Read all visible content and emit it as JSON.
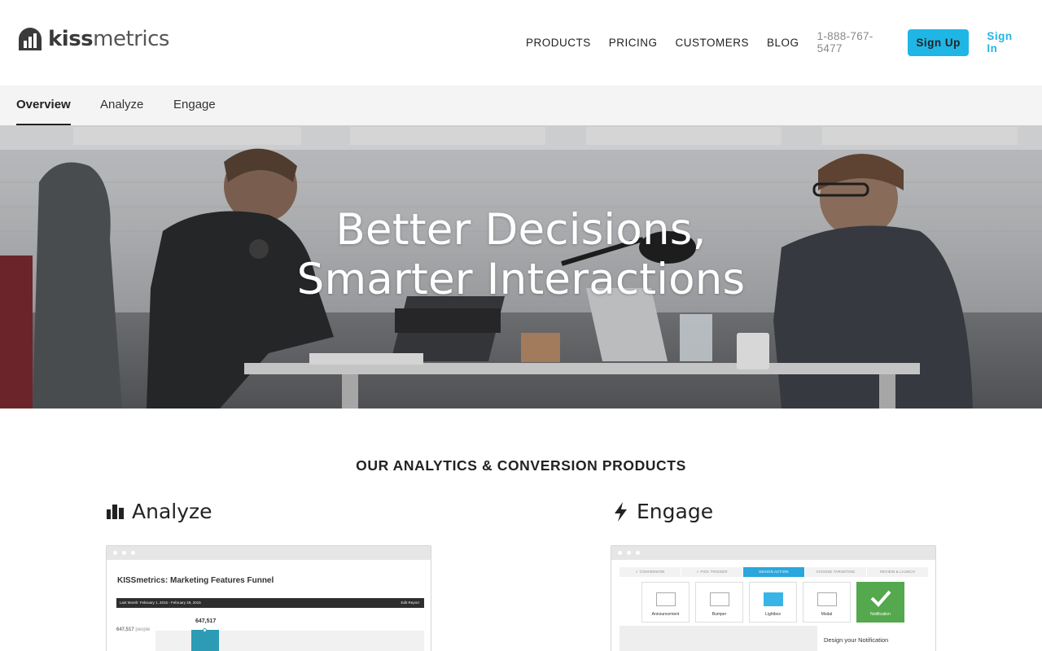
{
  "brand": {
    "name_bold": "kiss",
    "name_light": "metrics",
    "accent": "#1fb6e6"
  },
  "nav": {
    "items": [
      "PRODUCTS",
      "PRICING",
      "CUSTOMERS",
      "BLOG"
    ],
    "phone": "1-888-767-5477",
    "signup_label": "Sign Up",
    "signin_label": "Sign In"
  },
  "subnav": {
    "tabs": [
      "Overview",
      "Analyze",
      "Engage"
    ],
    "active": "Overview"
  },
  "hero": {
    "line1": "Better Decisions,",
    "line2": "Smarter Interactions"
  },
  "section": {
    "title": "OUR ANALYTICS & CONVERSION PRODUCTS"
  },
  "products": {
    "analyze": {
      "name": "Analyze",
      "icon": "bar-chart-icon",
      "card": {
        "title": "KISSmetrics: Marketing Features Funnel",
        "date_bar": "Last Month: February 1, 2015 - February 28, 2015",
        "edit_label": "Edit Report",
        "top_value": "647,517",
        "people_value": "647,517",
        "people_label": "people"
      }
    },
    "engage": {
      "name": "Engage",
      "icon": "lightning-icon",
      "card": {
        "steps": [
          "✓ CONVERSION",
          "✓ PICK TRIGGER",
          "DESIGN ACTION",
          "CHOOSE TARGETING",
          "REVIEW & LAUNCH"
        ],
        "tiles": [
          "Announcement",
          "Bumper",
          "Lightbox",
          "Modal",
          "Notification"
        ],
        "panel_title": "Design your Notification"
      }
    }
  }
}
